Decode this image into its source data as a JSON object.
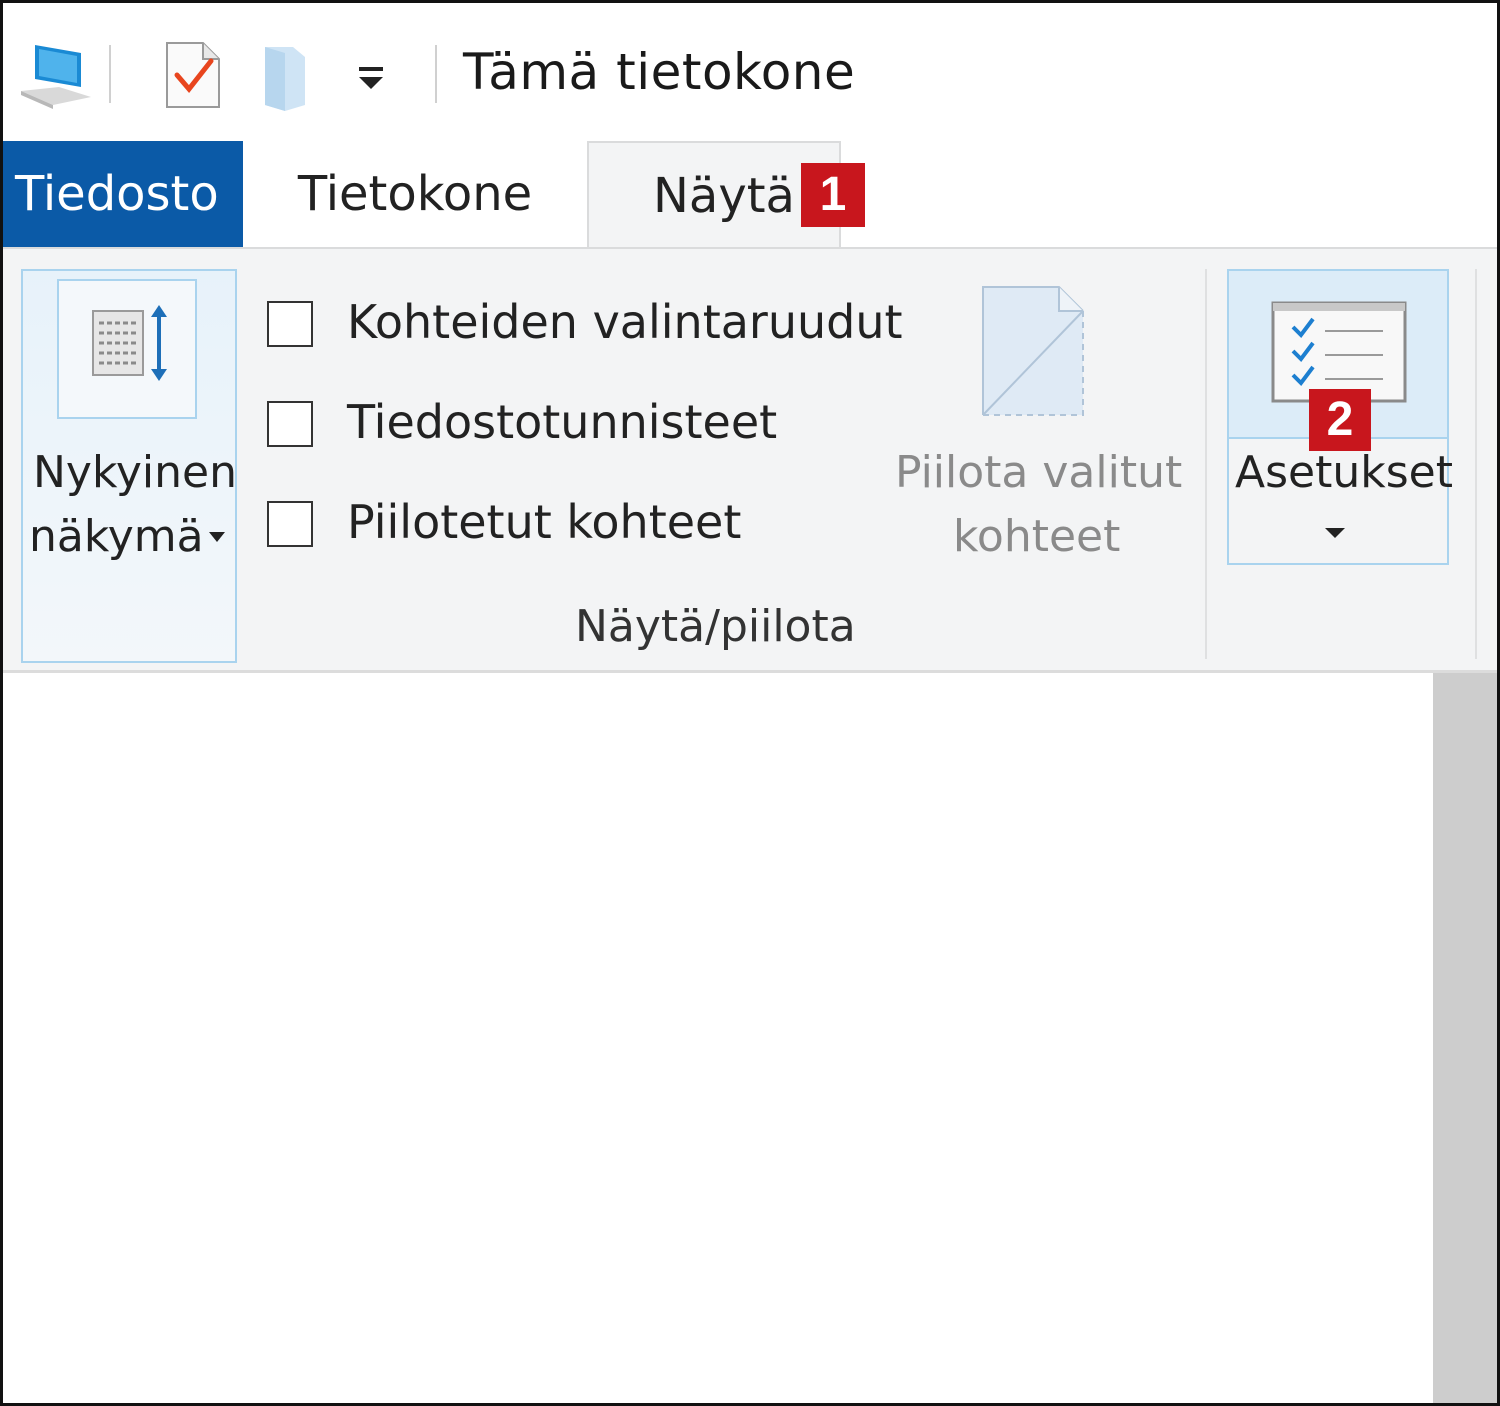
{
  "window": {
    "title": "Tämä tietokone",
    "colors": {
      "accent": "#0b5aa7",
      "badge": "#c8161d",
      "ribbon_bg": "#f3f4f5",
      "hover_border": "#a9d3ee",
      "scrollbar": "#cdcdcd"
    }
  },
  "quick_access": {
    "icons": [
      "computer-icon",
      "properties-icon",
      "new-folder-icon",
      "customize-arrow-icon"
    ]
  },
  "tabs": [
    {
      "label": "Tiedosto",
      "state": "file-menu"
    },
    {
      "label": "Tietokone",
      "state": "normal"
    },
    {
      "label": "Näytä",
      "state": "selected"
    }
  ],
  "badges": {
    "one": "1",
    "two": "2"
  },
  "ribbon": {
    "current_view": {
      "line1": "Nykyinen",
      "line2": "näkymä"
    },
    "checkboxes": [
      {
        "label": "Kohteiden valintaruudut",
        "checked": false
      },
      {
        "label": "Tiedostotunnisteet",
        "checked": false
      },
      {
        "label": "Piilotetut kohteet",
        "checked": false
      }
    ],
    "hide_selected": {
      "line1": "Piilota valitut",
      "line2": "kohteet",
      "disabled": true
    },
    "group_label": "Näytä/piilota",
    "settings": {
      "label": "Asetukset"
    }
  }
}
